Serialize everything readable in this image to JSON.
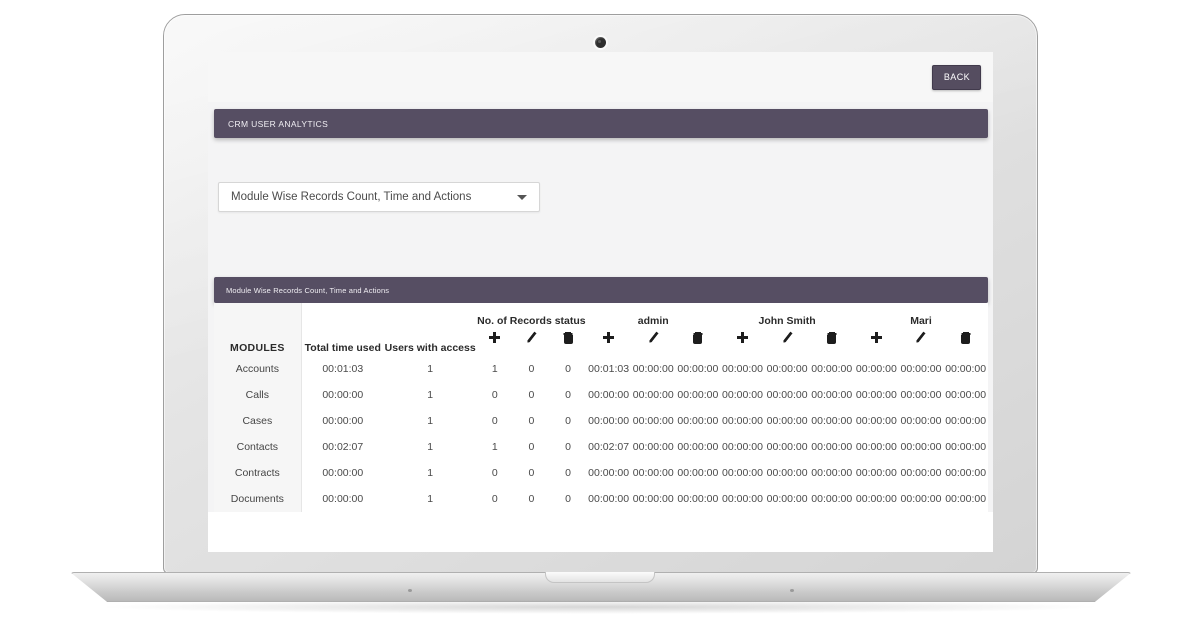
{
  "device": {
    "type": "laptop",
    "webcam_icon": "webcam-icon"
  },
  "screen": {
    "topbar": {
      "back_label": "BACK"
    },
    "app_header": {
      "title": "CRM USER ANALYTICS"
    },
    "report_select": {
      "value": "Module Wise Records Count, Time and Actions",
      "caret_icon": "chevron-down-icon"
    },
    "table_panel": {
      "title": "Module Wise Records Count, Time and Actions"
    }
  },
  "colors": {
    "panel_bar": "#564e63",
    "back_button": "#554d60",
    "page_background": "#f4f4f5",
    "table_background": "#ffffff",
    "modules_column": "#f6f6f6"
  },
  "table": {
    "base_headers": {
      "modules": "MODULES",
      "total_time": "Total time used",
      "users_with_access": "Users with access"
    },
    "group_headers": [
      {
        "label": "No. of Records status",
        "kind": "counts"
      },
      {
        "label": "admin",
        "kind": "times"
      },
      {
        "label": "John Smith",
        "kind": "times"
      },
      {
        "label": "Mari",
        "kind": "times",
        "truncated": true
      }
    ],
    "action_icons": [
      {
        "name": "add-icon",
        "label": "add"
      },
      {
        "name": "edit-icon",
        "label": "edit"
      },
      {
        "name": "delete-icon",
        "label": "delete"
      }
    ],
    "rows": [
      {
        "module": "Accounts",
        "total_time": "00:01:03",
        "users_with_access": "1",
        "records_status": [
          "1",
          "0",
          "0"
        ],
        "admin": [
          "00:01:03",
          "00:00:00",
          "00:00:00"
        ],
        "john_smith": [
          "00:00:00",
          "00:00:00",
          "00:00:00"
        ],
        "mari": [
          "00:00:00",
          "00:00:00",
          "00:00:00"
        ]
      },
      {
        "module": "Calls",
        "total_time": "00:00:00",
        "users_with_access": "1",
        "records_status": [
          "0",
          "0",
          "0"
        ],
        "admin": [
          "00:00:00",
          "00:00:00",
          "00:00:00"
        ],
        "john_smith": [
          "00:00:00",
          "00:00:00",
          "00:00:00"
        ],
        "mari": [
          "00:00:00",
          "00:00:00",
          "00:00:00"
        ]
      },
      {
        "module": "Cases",
        "total_time": "00:00:00",
        "users_with_access": "1",
        "records_status": [
          "0",
          "0",
          "0"
        ],
        "admin": [
          "00:00:00",
          "00:00:00",
          "00:00:00"
        ],
        "john_smith": [
          "00:00:00",
          "00:00:00",
          "00:00:00"
        ],
        "mari": [
          "00:00:00",
          "00:00:00",
          "00:00:00"
        ]
      },
      {
        "module": "Contacts",
        "total_time": "00:02:07",
        "users_with_access": "1",
        "records_status": [
          "1",
          "0",
          "0"
        ],
        "admin": [
          "00:02:07",
          "00:00:00",
          "00:00:00"
        ],
        "john_smith": [
          "00:00:00",
          "00:00:00",
          "00:00:00"
        ],
        "mari": [
          "00:00:00",
          "00:00:00",
          "00:00:00"
        ]
      },
      {
        "module": "Contracts",
        "total_time": "00:00:00",
        "users_with_access": "1",
        "records_status": [
          "0",
          "0",
          "0"
        ],
        "admin": [
          "00:00:00",
          "00:00:00",
          "00:00:00"
        ],
        "john_smith": [
          "00:00:00",
          "00:00:00",
          "00:00:00"
        ],
        "mari": [
          "00:00:00",
          "00:00:00",
          "00:00:00"
        ]
      },
      {
        "module": "Documents",
        "total_time": "00:00:00",
        "users_with_access": "1",
        "records_status": [
          "0",
          "0",
          "0"
        ],
        "admin": [
          "00:00:00",
          "00:00:00",
          "00:00:00"
        ],
        "john_smith": [
          "00:00:00",
          "00:00:00",
          "00:00:00"
        ],
        "mari": [
          "00:00:00",
          "00:00:00",
          "00:00:00"
        ]
      }
    ]
  }
}
